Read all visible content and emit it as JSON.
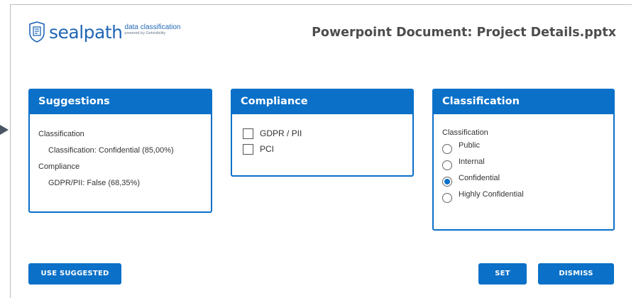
{
  "brand": {
    "word": "sealpath",
    "tagline": "data classification",
    "powered": "powered by Getvisibility",
    "icon": "document-list-icon",
    "color": "#1f66b5"
  },
  "document_title": "Powerpoint Document: Project Details.pptx",
  "accent_color": "#0a70c8",
  "suggestions": {
    "header": "Suggestions",
    "classification_label": "Classification",
    "classification_value": "Classification: Confidential (85,00%)",
    "compliance_label": "Compliance",
    "compliance_value": "GDPR/PII: False (68,35%)"
  },
  "compliance": {
    "header": "Compliance",
    "options": [
      {
        "label": "GDPR / PII",
        "checked": false
      },
      {
        "label": "PCI",
        "checked": false
      }
    ]
  },
  "classification": {
    "header": "Classification",
    "label": "Classification",
    "options": [
      {
        "label": "Public",
        "selected": false
      },
      {
        "label": "Internal",
        "selected": false
      },
      {
        "label": "Confidential",
        "selected": true
      },
      {
        "label": "Highly Confidential",
        "selected": false
      }
    ]
  },
  "buttons": {
    "use_suggested": "USE SUGGESTED",
    "set": "SET",
    "dismiss": "DISMISS"
  }
}
